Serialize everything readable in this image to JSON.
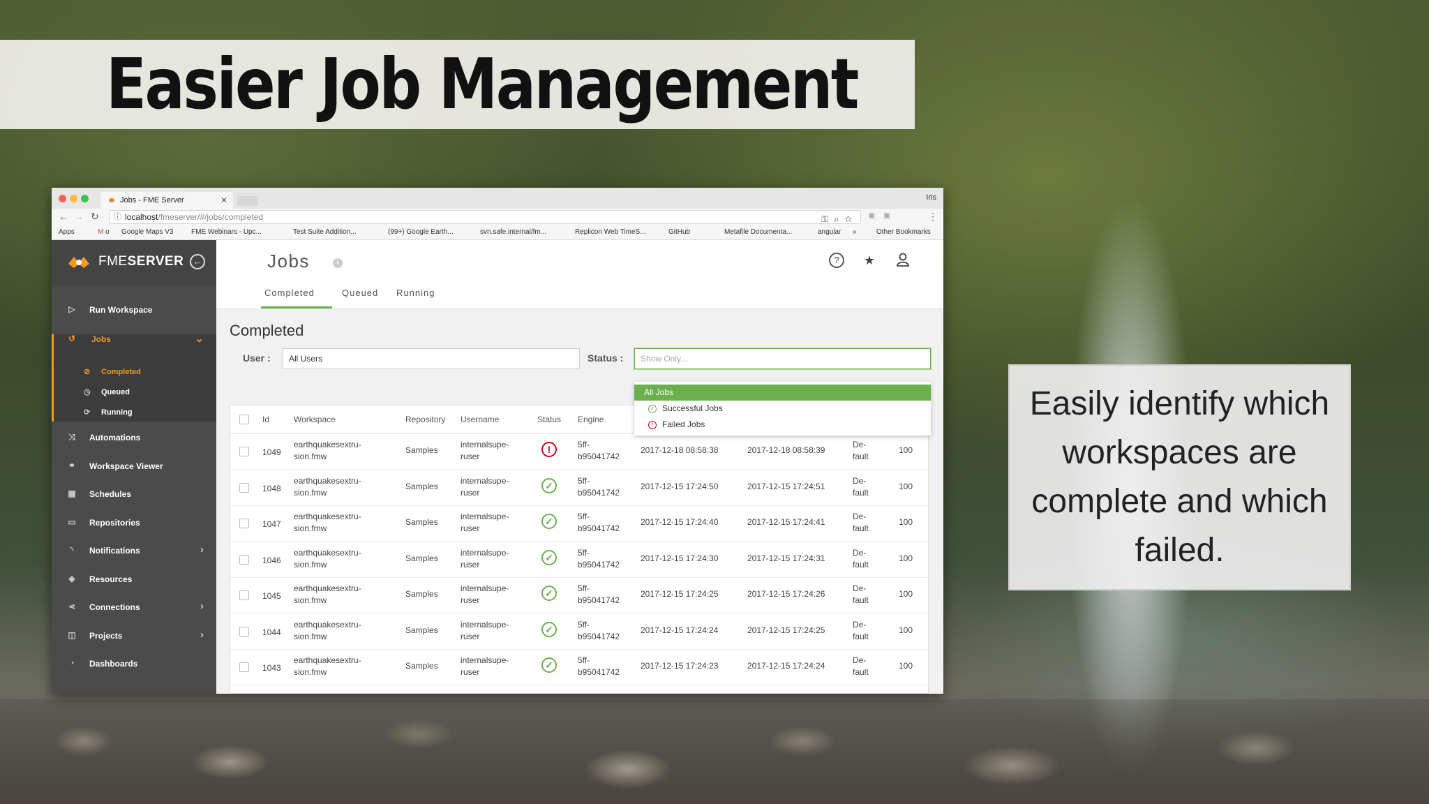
{
  "slide": {
    "title": "Easier Job Management",
    "callout": "Easily identify which workspaces are complete and which failed."
  },
  "browser": {
    "tab_title": "Jobs - FME Server",
    "profile": "Iris",
    "url_host": "localhost",
    "url_path": "/fmeserver/#/jobs/completed",
    "bookmarks": [
      "Apps",
      "o",
      "Google Maps V3",
      "FME Webinars - Upc...",
      "Test Suite Addition...",
      "(99+) Google Earth...",
      "svn.safe.internal/fm...",
      "Replicon Web TimeS...",
      "GitHub",
      "Metafile Documenta...",
      "angular",
      "»",
      "Other Bookmarks"
    ]
  },
  "sidebar": {
    "brand_light": "FME",
    "brand_bold": "SERVER",
    "items": [
      {
        "label": "Run Workspace",
        "icon": "play-icon"
      },
      {
        "label": "Jobs",
        "icon": "jobs-icon"
      },
      {
        "label": "Automations",
        "icon": "shuffle-icon"
      },
      {
        "label": "Workspace Viewer",
        "icon": "binoculars-icon"
      },
      {
        "label": "Schedules",
        "icon": "calendar-icon"
      },
      {
        "label": "Repositories",
        "icon": "folder-icon"
      },
      {
        "label": "Notifications",
        "icon": "rss-icon"
      },
      {
        "label": "Resources",
        "icon": "layers-icon"
      },
      {
        "label": "Connections",
        "icon": "share-icon"
      },
      {
        "label": "Projects",
        "icon": "book-icon"
      },
      {
        "label": "Dashboards",
        "icon": "dashboard-icon"
      }
    ],
    "jobs_sub": [
      "Completed",
      "Queued",
      "Running"
    ]
  },
  "main": {
    "title": "Jobs",
    "tabs": [
      "Completed",
      "Queued",
      "Running"
    ],
    "section_title": "Completed",
    "user_label": "User :",
    "user_value": "All Users",
    "status_label": "Status :",
    "status_placeholder": "Show Only...",
    "dropdown": [
      "All Jobs",
      "Successful Jobs",
      "Failed Jobs"
    ]
  },
  "table": {
    "columns": [
      "Id",
      "Workspace",
      "Repository",
      "Username",
      "Status",
      "Engine"
    ],
    "rows": [
      {
        "id": "1049",
        "ws1": "earthquakesextru-",
        "ws2": "sion.fmw",
        "repo": "Samples",
        "u1": "internalsupe-",
        "u2": "ruser",
        "status": "failed",
        "e1": "5ff-",
        "e2": "b95041742",
        "submitted": "2017-12-18 08:58:38",
        "finished": "2017-12-18 08:58:39",
        "q1": "De-",
        "q2": "fault",
        "priority": "100"
      },
      {
        "id": "1048",
        "ws1": "earthquakesextru-",
        "ws2": "sion.fmw",
        "repo": "Samples",
        "u1": "internalsupe-",
        "u2": "ruser",
        "status": "success",
        "e1": "5ff-",
        "e2": "b95041742",
        "submitted": "2017-12-15 17:24:50",
        "finished": "2017-12-15 17:24:51",
        "q1": "De-",
        "q2": "fault",
        "priority": "100"
      },
      {
        "id": "1047",
        "ws1": "earthquakesextru-",
        "ws2": "sion.fmw",
        "repo": "Samples",
        "u1": "internalsupe-",
        "u2": "ruser",
        "status": "success",
        "e1": "5ff-",
        "e2": "b95041742",
        "submitted": "2017-12-15 17:24:40",
        "finished": "2017-12-15 17:24:41",
        "q1": "De-",
        "q2": "fault",
        "priority": "100"
      },
      {
        "id": "1046",
        "ws1": "earthquakesextru-",
        "ws2": "sion.fmw",
        "repo": "Samples",
        "u1": "internalsupe-",
        "u2": "ruser",
        "status": "success",
        "e1": "5ff-",
        "e2": "b95041742",
        "submitted": "2017-12-15 17:24:30",
        "finished": "2017-12-15 17:24:31",
        "q1": "De-",
        "q2": "fault",
        "priority": "100"
      },
      {
        "id": "1045",
        "ws1": "earthquakesextru-",
        "ws2": "sion.fmw",
        "repo": "Samples",
        "u1": "internalsupe-",
        "u2": "ruser",
        "status": "success",
        "e1": "5ff-",
        "e2": "b95041742",
        "submitted": "2017-12-15 17:24:25",
        "finished": "2017-12-15 17:24:26",
        "q1": "De-",
        "q2": "fault",
        "priority": "100"
      },
      {
        "id": "1044",
        "ws1": "earthquakesextru-",
        "ws2": "sion.fmw",
        "repo": "Samples",
        "u1": "internalsupe-",
        "u2": "ruser",
        "status": "success",
        "e1": "5ff-",
        "e2": "b95041742",
        "submitted": "2017-12-15 17:24:24",
        "finished": "2017-12-15 17:24:25",
        "q1": "De-",
        "q2": "fault",
        "priority": "100"
      },
      {
        "id": "1043",
        "ws1": "earthquakesextru-",
        "ws2": "sion.fmw",
        "repo": "Samples",
        "u1": "internalsupe-",
        "u2": "ruser",
        "status": "success",
        "e1": "5ff-",
        "e2": "b95041742",
        "submitted": "2017-12-15 17:24:23",
        "finished": "2017-12-15 17:24:24",
        "q1": "De-",
        "q2": "fault",
        "priority": "100"
      }
    ]
  },
  "colors": {
    "accent": "#6ab04c",
    "brand": "#f19a23",
    "fail": "#d0021b",
    "sidebar": "#4b4b4b"
  }
}
